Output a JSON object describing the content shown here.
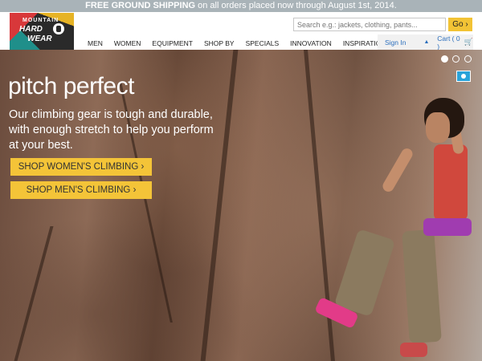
{
  "promo": {
    "bold": "FREE GROUND SHIPPING",
    "text": " on all orders placed now through August 1st, 2014."
  },
  "logo": {
    "line1": "MOUNTAIN",
    "line2": "HARD",
    "line3": "WEAR"
  },
  "search": {
    "placeholder": "Search e.g.: jackets, clothing, pants...",
    "go_label": "Go ›"
  },
  "nav": {
    "items": [
      {
        "label": "MEN"
      },
      {
        "label": "WOMEN"
      },
      {
        "label": "EQUIPMENT"
      },
      {
        "label": "SHOP BY"
      },
      {
        "label": "SPECIALS"
      },
      {
        "label": "INNOVATION"
      },
      {
        "label": "INSPIRATION"
      }
    ]
  },
  "account": {
    "signin": "Sign In",
    "cart": "Cart ( 0 )"
  },
  "hero": {
    "title": "pitch perfect",
    "text": "Our climbing gear is tough and durable, with enough stretch to help you perform at your best.",
    "cta_women": "SHOP WOMEN'S CLIMBING ›",
    "cta_men": "SHOP MEN'S CLIMBING ›",
    "pager_count": 3,
    "pager_active": 1
  },
  "colors": {
    "promo_bg": "#a9b3b8",
    "cta_bg": "#f4c438",
    "link": "#2c6fbd",
    "camera": "#2aa3d9"
  }
}
